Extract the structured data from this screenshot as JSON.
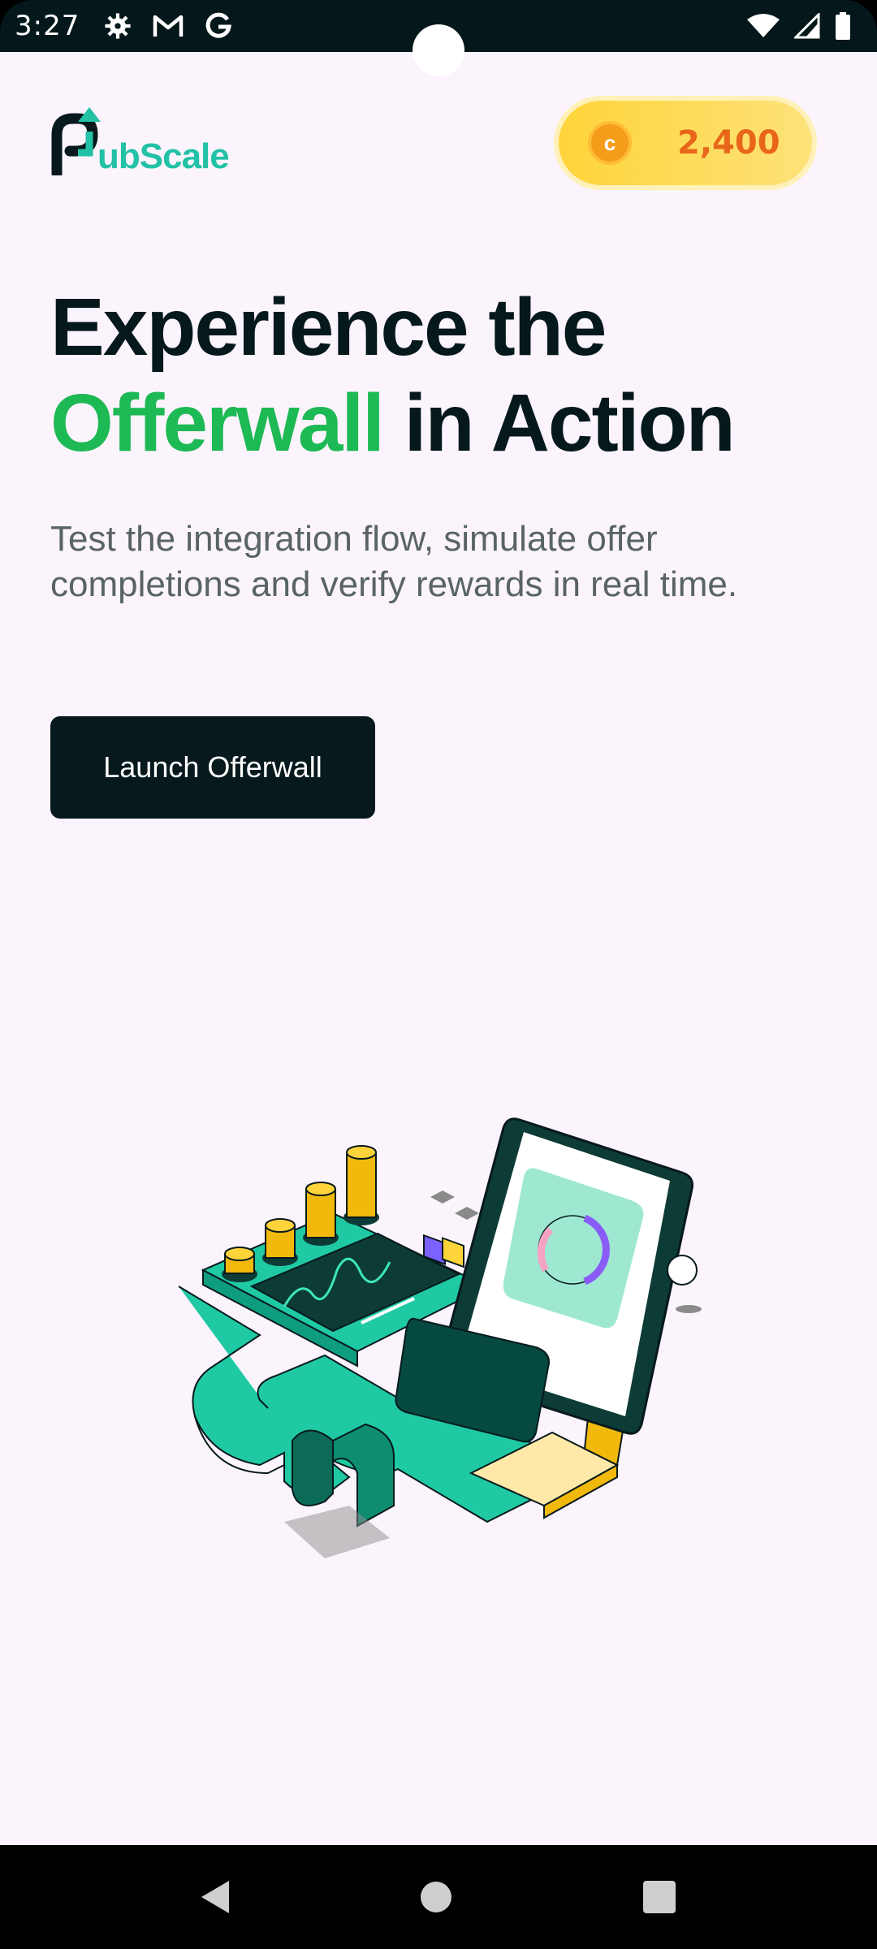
{
  "status_bar": {
    "time": "3:27",
    "left_icons": [
      "gear-icon",
      "gmail-icon",
      "google-icon"
    ],
    "right_icons": [
      "wifi-icon",
      "signal-icon",
      "battery-icon"
    ]
  },
  "header": {
    "logo_text": "ubScale",
    "coin_symbol": "c",
    "coin_balance": "2,400"
  },
  "hero": {
    "headline_line1": "Experience the",
    "headline_highlight": "Offerwall",
    "headline_rest": " in Action",
    "subtitle": "Test the integration flow, simulate offer completions and verify rewards in real time."
  },
  "actions": {
    "launch_label": "Launch Offerwall"
  },
  "colors": {
    "accent_green": "#1db954",
    "dark": "#07191c",
    "teal": "#1fc9a4",
    "coin_text": "#e8661a",
    "background": "#fcf4fc"
  },
  "nav_bar": {
    "icons": [
      "back-icon",
      "home-icon",
      "recents-icon"
    ]
  }
}
